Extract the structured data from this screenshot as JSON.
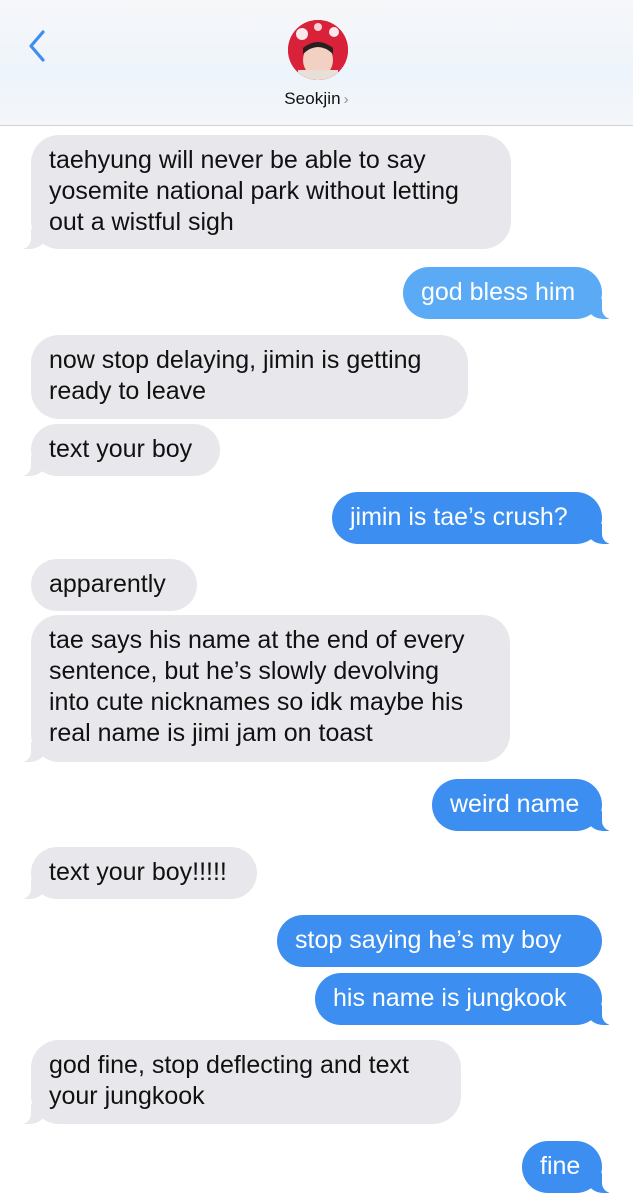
{
  "header": {
    "contact_name": "Seokjin",
    "chevron": "›",
    "back_icon": "chevron-left-icon",
    "accent_color": "#3c8ff0"
  },
  "messages": [
    {
      "sender": "them",
      "text": "taehyung will never be able to say\nyosemite national park without letting\nout a wistful sigh"
    },
    {
      "sender": "me",
      "text": "god bless him"
    },
    {
      "sender": "them",
      "text": "now stop delaying, jimin is getting\nready to leave"
    },
    {
      "sender": "them",
      "text": "text your boy"
    },
    {
      "sender": "me",
      "text": "jimin is tae’s crush?"
    },
    {
      "sender": "them",
      "text": "apparently"
    },
    {
      "sender": "them",
      "text": "tae says his name at the end of every\nsentence, but he’s slowly devolving\ninto cute nicknames so idk maybe his\nreal name is jimi jam on toast"
    },
    {
      "sender": "me",
      "text": "weird name"
    },
    {
      "sender": "them",
      "text": "text your boy!!!!!"
    },
    {
      "sender": "me",
      "text": "stop saying he’s my boy"
    },
    {
      "sender": "me",
      "text": "his name is jungkook"
    },
    {
      "sender": "them",
      "text": "god fine, stop deflecting and text\nyour jungkook"
    },
    {
      "sender": "me",
      "text": "fine"
    }
  ]
}
